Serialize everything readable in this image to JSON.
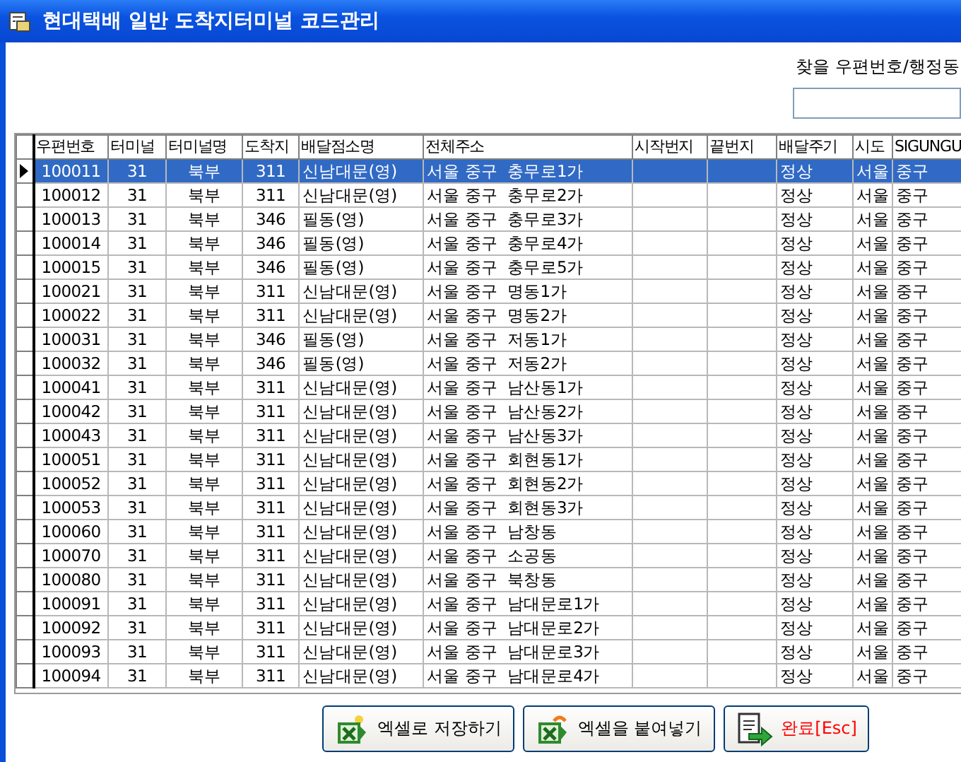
{
  "window": {
    "title": "현대택배 일반 도착지터미널 코드관리"
  },
  "search": {
    "label": "찾을 우편번호/행정동"
  },
  "table": {
    "columns": [
      "우편번호",
      "터미널",
      "터미널명",
      "도착지",
      "배달점소명",
      "전체주소",
      "시작번지",
      "끝번지",
      "배달주기",
      "시도",
      "SIGUNGU"
    ],
    "rows": [
      {
        "selected": true,
        "cells": [
          "100011",
          "31",
          "북부",
          "311",
          "신남대문(영)",
          "서울 중구  충무로1가",
          "",
          "",
          "정상",
          "서울",
          "중구"
        ]
      },
      {
        "selected": false,
        "cells": [
          "100012",
          "31",
          "북부",
          "311",
          "신남대문(영)",
          "서울 중구  충무로2가",
          "",
          "",
          "정상",
          "서울",
          "중구"
        ]
      },
      {
        "selected": false,
        "cells": [
          "100013",
          "31",
          "북부",
          "346",
          "필동(영)",
          "서울 중구  충무로3가",
          "",
          "",
          "정상",
          "서울",
          "중구"
        ]
      },
      {
        "selected": false,
        "cells": [
          "100014",
          "31",
          "북부",
          "346",
          "필동(영)",
          "서울 중구  충무로4가",
          "",
          "",
          "정상",
          "서울",
          "중구"
        ]
      },
      {
        "selected": false,
        "cells": [
          "100015",
          "31",
          "북부",
          "346",
          "필동(영)",
          "서울 중구  충무로5가",
          "",
          "",
          "정상",
          "서울",
          "중구"
        ]
      },
      {
        "selected": false,
        "cells": [
          "100021",
          "31",
          "북부",
          "311",
          "신남대문(영)",
          "서울 중구  명동1가",
          "",
          "",
          "정상",
          "서울",
          "중구"
        ]
      },
      {
        "selected": false,
        "cells": [
          "100022",
          "31",
          "북부",
          "311",
          "신남대문(영)",
          "서울 중구  명동2가",
          "",
          "",
          "정상",
          "서울",
          "중구"
        ]
      },
      {
        "selected": false,
        "cells": [
          "100031",
          "31",
          "북부",
          "346",
          "필동(영)",
          "서울 중구  저동1가",
          "",
          "",
          "정상",
          "서울",
          "중구"
        ]
      },
      {
        "selected": false,
        "cells": [
          "100032",
          "31",
          "북부",
          "346",
          "필동(영)",
          "서울 중구  저동2가",
          "",
          "",
          "정상",
          "서울",
          "중구"
        ]
      },
      {
        "selected": false,
        "cells": [
          "100041",
          "31",
          "북부",
          "311",
          "신남대문(영)",
          "서울 중구  남산동1가",
          "",
          "",
          "정상",
          "서울",
          "중구"
        ]
      },
      {
        "selected": false,
        "cells": [
          "100042",
          "31",
          "북부",
          "311",
          "신남대문(영)",
          "서울 중구  남산동2가",
          "",
          "",
          "정상",
          "서울",
          "중구"
        ]
      },
      {
        "selected": false,
        "cells": [
          "100043",
          "31",
          "북부",
          "311",
          "신남대문(영)",
          "서울 중구  남산동3가",
          "",
          "",
          "정상",
          "서울",
          "중구"
        ]
      },
      {
        "selected": false,
        "cells": [
          "100051",
          "31",
          "북부",
          "311",
          "신남대문(영)",
          "서울 중구  회현동1가",
          "",
          "",
          "정상",
          "서울",
          "중구"
        ]
      },
      {
        "selected": false,
        "cells": [
          "100052",
          "31",
          "북부",
          "311",
          "신남대문(영)",
          "서울 중구  회현동2가",
          "",
          "",
          "정상",
          "서울",
          "중구"
        ]
      },
      {
        "selected": false,
        "cells": [
          "100053",
          "31",
          "북부",
          "311",
          "신남대문(영)",
          "서울 중구  회현동3가",
          "",
          "",
          "정상",
          "서울",
          "중구"
        ]
      },
      {
        "selected": false,
        "cells": [
          "100060",
          "31",
          "북부",
          "311",
          "신남대문(영)",
          "서울 중구  남창동",
          "",
          "",
          "정상",
          "서울",
          "중구"
        ]
      },
      {
        "selected": false,
        "cells": [
          "100070",
          "31",
          "북부",
          "311",
          "신남대문(영)",
          "서울 중구  소공동",
          "",
          "",
          "정상",
          "서울",
          "중구"
        ]
      },
      {
        "selected": false,
        "cells": [
          "100080",
          "31",
          "북부",
          "311",
          "신남대문(영)",
          "서울 중구  북창동",
          "",
          "",
          "정상",
          "서울",
          "중구"
        ]
      },
      {
        "selected": false,
        "cells": [
          "100091",
          "31",
          "북부",
          "311",
          "신남대문(영)",
          "서울 중구  남대문로1가",
          "",
          "",
          "정상",
          "서울",
          "중구"
        ]
      },
      {
        "selected": false,
        "cells": [
          "100092",
          "31",
          "북부",
          "311",
          "신남대문(영)",
          "서울 중구  남대문로2가",
          "",
          "",
          "정상",
          "서울",
          "중구"
        ]
      },
      {
        "selected": false,
        "cells": [
          "100093",
          "31",
          "북부",
          "311",
          "신남대문(영)",
          "서울 중구  남대문로3가",
          "",
          "",
          "정상",
          "서울",
          "중구"
        ]
      },
      {
        "selected": false,
        "cells": [
          "100094",
          "31",
          "북부",
          "311",
          "신남대문(영)",
          "서울 중구  남대문로4가",
          "",
          "",
          "정상",
          "서울",
          "중구"
        ]
      }
    ]
  },
  "buttons": [
    {
      "kind": "excel-save",
      "label": "엑셀로 저장하기"
    },
    {
      "kind": "excel-paste",
      "label": "엑셀을 붙여넣기"
    },
    {
      "kind": "exit",
      "label": "완료[Esc]"
    }
  ]
}
